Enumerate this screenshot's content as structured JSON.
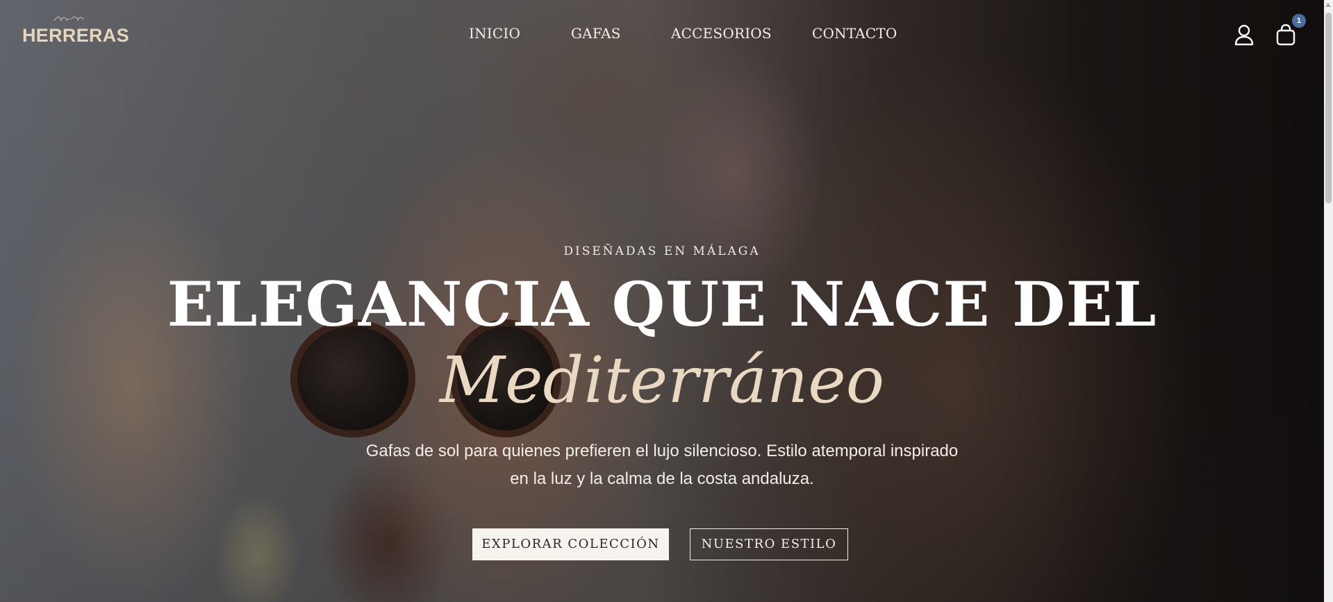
{
  "brand": {
    "logo_text": "HERRERAS"
  },
  "nav": {
    "items": [
      {
        "label": "INICIO"
      },
      {
        "label": "GAFAS"
      },
      {
        "label": "ACCESORIOS"
      },
      {
        "label": "CONTACTO"
      }
    ]
  },
  "header": {
    "account_icon": "user-icon",
    "cart_icon": "shopping-bag-icon",
    "cart_count": "1"
  },
  "hero": {
    "eyebrow": "DISEÑADAS EN MÁLAGA",
    "headline": "ELEGANCIA QUE NACE DEL",
    "headline_accent": "Mediterráneo",
    "description_line1": "Gafas de sol para quienes prefieren el lujo silencioso. Estilo atemporal inspirado",
    "description_line2": "en la luz y la calma de la costa andaluza.",
    "primary_button": "EXPLORAR COLECCIÓN",
    "secondary_button": "NUESTRO ESTILO"
  },
  "colors": {
    "brand_cream": "#e6d6bc",
    "accent_cream": "#ead9c2",
    "badge_blue": "#4a6da4",
    "button_light": "#f7f3ee"
  }
}
